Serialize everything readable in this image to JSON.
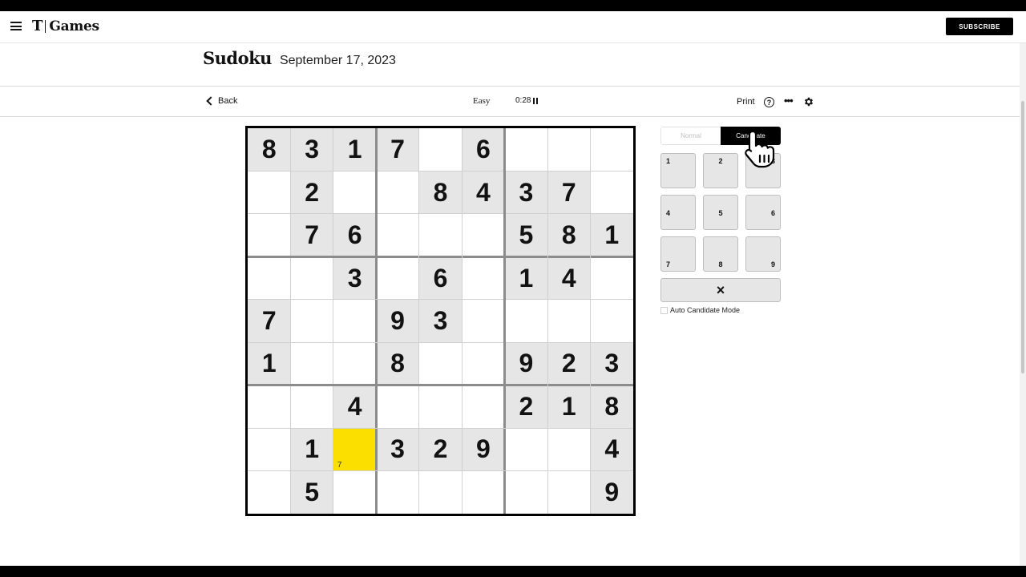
{
  "header": {
    "brand_logo": "T",
    "brand_name": "Games",
    "subscribe_label": "SUBSCRIBE"
  },
  "title": {
    "game": "Sudoku",
    "date": "September 17, 2023"
  },
  "toolbar": {
    "back_label": "Back",
    "difficulty": "Easy",
    "timer": "0:28",
    "print_label": "Print",
    "help_icon": "?",
    "more_icon": "•••"
  },
  "board": {
    "rows": [
      [
        "8",
        "3",
        "1",
        "7",
        "",
        "6",
        "",
        "",
        ""
      ],
      [
        "",
        "2",
        "",
        "",
        "8",
        "4",
        "3",
        "7",
        ""
      ],
      [
        "",
        "7",
        "6",
        "",
        "",
        "",
        "5",
        "8",
        "1"
      ],
      [
        "",
        "",
        "3",
        "",
        "6",
        "",
        "1",
        "4",
        ""
      ],
      [
        "7",
        "",
        "",
        "9",
        "3",
        "",
        "",
        "",
        ""
      ],
      [
        "1",
        "",
        "",
        "8",
        "",
        "",
        "9",
        "2",
        "3"
      ],
      [
        "",
        "",
        "4",
        "",
        "",
        "",
        "2",
        "1",
        "8"
      ],
      [
        "",
        "1",
        "",
        "3",
        "2",
        "9",
        "",
        "",
        "4"
      ],
      [
        "",
        "5",
        "",
        "",
        "",
        "",
        "",
        "",
        "9"
      ]
    ],
    "selected": [
      7,
      2
    ],
    "selected_candidate": "7",
    "colors": {
      "given": "#e6e6e6",
      "selected": "#fbdf00"
    }
  },
  "panel": {
    "mode_normal": "Normal",
    "mode_candidate": "Candidate",
    "keys": [
      "1",
      "2",
      "3",
      "4",
      "5",
      "6",
      "7",
      "8",
      "9"
    ],
    "erase_icon": "×",
    "auto_candidate_label": "Auto Candidate Mode"
  }
}
